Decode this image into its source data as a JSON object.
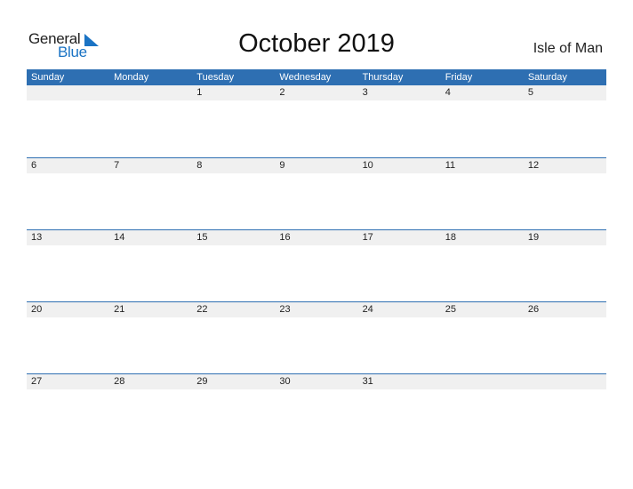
{
  "logo": {
    "text_general": "General",
    "text_blue": "Blue",
    "icon": "triangle-flag-icon"
  },
  "title": "October 2019",
  "country": "Isle of Man",
  "weekdays": [
    "Sunday",
    "Monday",
    "Tuesday",
    "Wednesday",
    "Thursday",
    "Friday",
    "Saturday"
  ],
  "weeks": [
    [
      "",
      "",
      "1",
      "2",
      "3",
      "4",
      "5"
    ],
    [
      "6",
      "7",
      "8",
      "9",
      "10",
      "11",
      "12"
    ],
    [
      "13",
      "14",
      "15",
      "16",
      "17",
      "18",
      "19"
    ],
    [
      "20",
      "21",
      "22",
      "23",
      "24",
      "25",
      "26"
    ],
    [
      "27",
      "28",
      "29",
      "30",
      "31",
      "",
      ""
    ]
  ],
  "colors": {
    "header_bg": "#2e6fb2",
    "brand_blue": "#1a73c4",
    "row_bg": "#f0f0f0"
  }
}
